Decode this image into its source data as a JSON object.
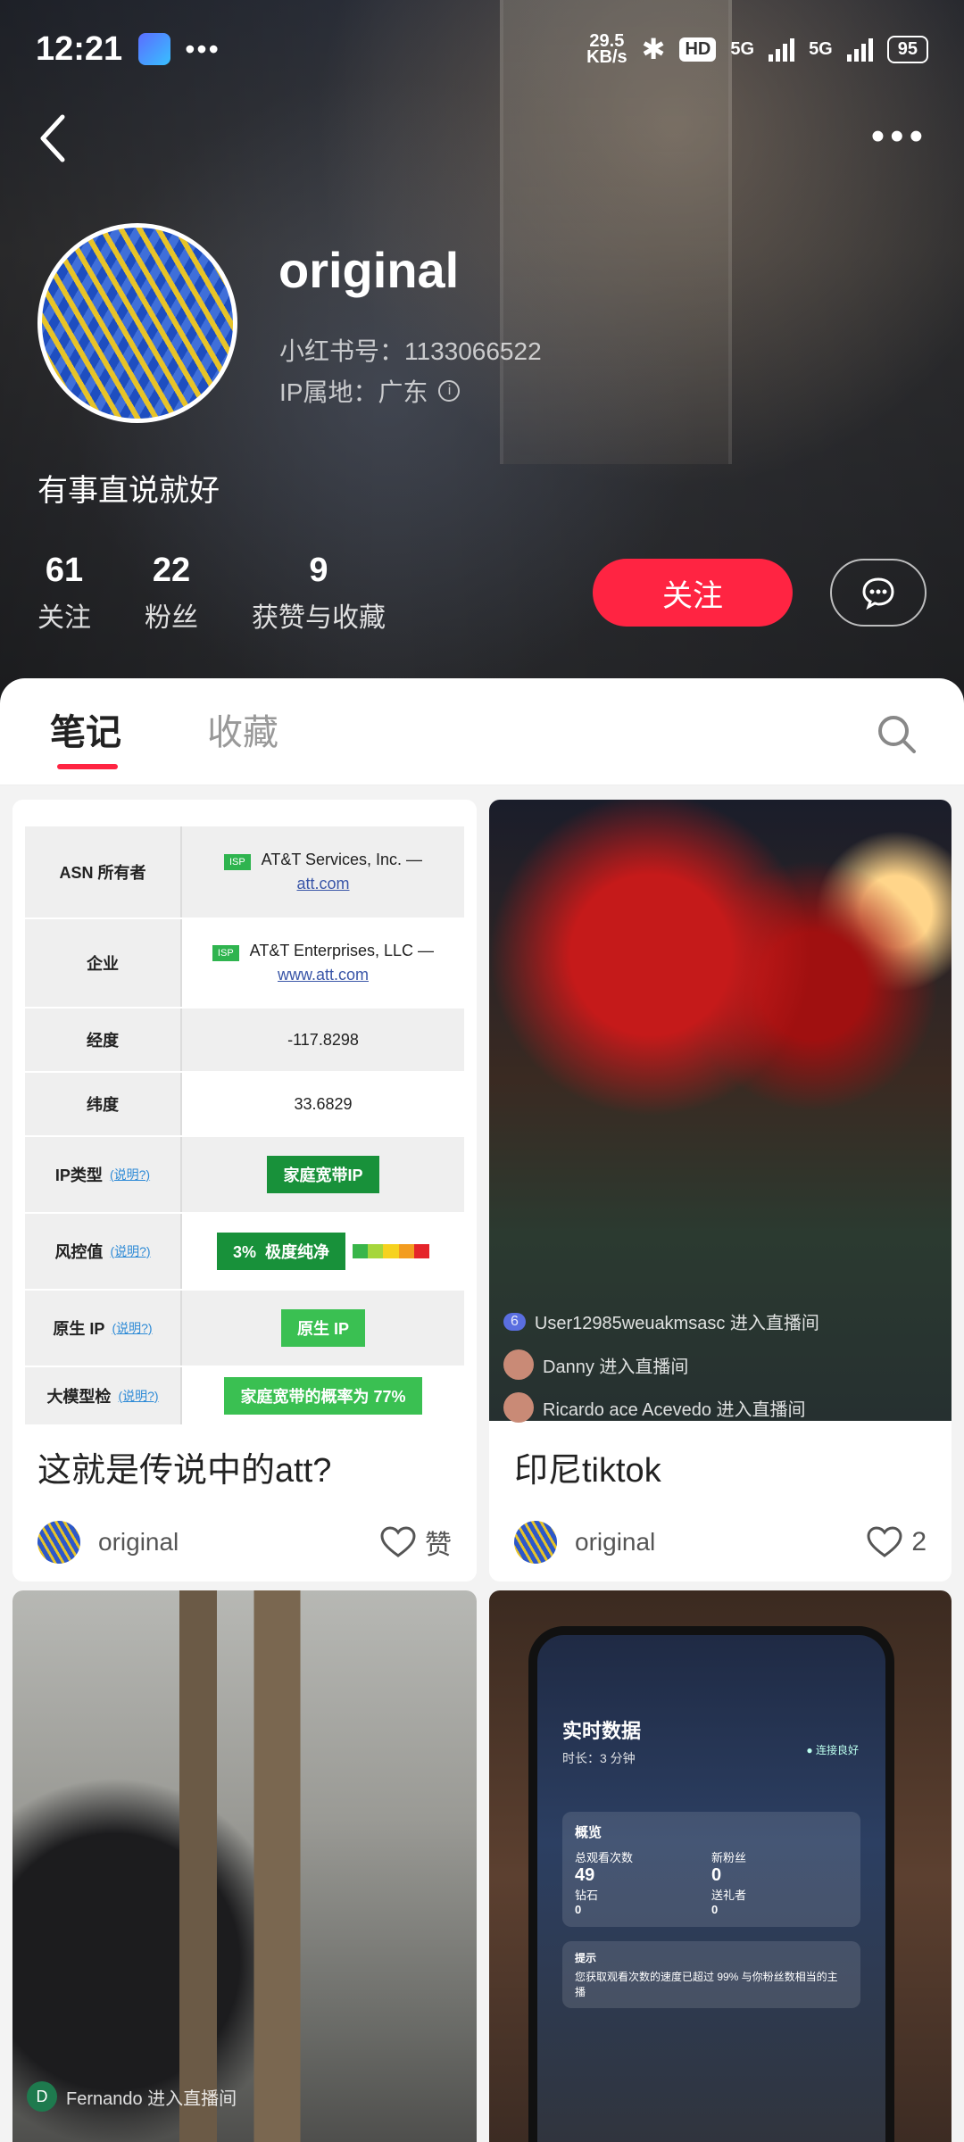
{
  "status_bar": {
    "time": "12:21",
    "net_speed": "29.5",
    "net_unit": "KB/s",
    "hd": "HD",
    "net1": "5G",
    "net2": "5G",
    "battery": "95"
  },
  "profile": {
    "name": "original",
    "red_id": "小红书号：1133066522",
    "ip_location": "IP属地：广东",
    "bio": "有事直说就好",
    "stats": [
      {
        "num": "61",
        "label": "关注"
      },
      {
        "num": "22",
        "label": "粉丝"
      },
      {
        "num": "9",
        "label": "获赞与收藏"
      }
    ],
    "follow_label": "关注"
  },
  "tabs": [
    {
      "label": "笔记"
    },
    {
      "label": "收藏"
    }
  ],
  "notes": [
    {
      "title": "这就是传说中的att?",
      "author": "original",
      "likes": "赞",
      "table": {
        "asn_label": "ASN 所有者",
        "asn_badge": "ISP",
        "asn_value": "AT&T Services, Inc. —",
        "asn_link": "att.com",
        "org_label": "企业",
        "org_badge": "ISP",
        "org_value": "AT&T Enterprises, LLC —",
        "org_link": "www.att.com",
        "lon_label": "经度",
        "lon_value": "-117.8298",
        "lat_label": "纬度",
        "lat_value": "33.6829",
        "iptype_label": "IP类型",
        "help": "(说明?)",
        "iptype_value": "家庭宽带IP",
        "risk_label": "风控值",
        "risk_value": "3%  极度纯净",
        "native_label": "原生 IP",
        "native_value": "原生 IP",
        "llm_label": "大模型检",
        "llm_help": "(说明?)",
        "llm_value": "家庭宽带的概率为 77%"
      }
    },
    {
      "title": "印尼tiktok",
      "author": "original",
      "likes": "2",
      "overlay": [
        {
          "badge": "6",
          "text": "User12985weuakmsasc 进入直播间"
        },
        {
          "text": "Danny 进入直播间"
        },
        {
          "text": "Ricardo ace Acevedo 进入直播间"
        }
      ]
    },
    {
      "overlay": [
        {
          "initial": "D",
          "text": "Fernando 进入直播间"
        }
      ]
    },
    {
      "phone": {
        "title": "实时数据",
        "duration": "时长：3 分钟",
        "conn": "● 连接良好",
        "overview": "概览",
        "views_label": "总观看次数",
        "views": "49",
        "fans_label": "新粉丝",
        "fans": "0",
        "diamonds_label": "钻石",
        "diamonds": "0",
        "gifters_label": "送礼者",
        "gifters": "0",
        "tip_label": "提示",
        "tip": "您获取观看次数的速度已超过 99% 与你粉丝数相当的主播"
      }
    }
  ]
}
